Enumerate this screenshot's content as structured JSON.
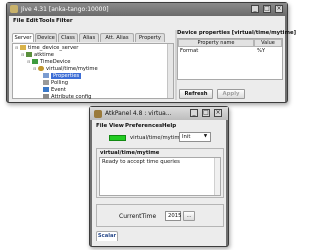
{
  "colors": {
    "state_on": "#22cc22",
    "selection": "#3d6ed6"
  },
  "jive": {
    "title": "Jive 4.31  [anka-tango:10000]",
    "menu": [
      "File",
      "Edit",
      "Tools",
      "Filter"
    ],
    "tabs": [
      "Server",
      "Device",
      "Class",
      "Alias",
      "Att. Alias",
      "Property"
    ],
    "tree": [
      {
        "label": "time_device_server",
        "icon": "folder-icon"
      },
      {
        "label": "atktime",
        "icon": "server-icon"
      },
      {
        "label": "TimeDevice",
        "icon": "class-icon"
      },
      {
        "label": "virtual/time/mytime",
        "icon": "device-icon"
      },
      {
        "label": "Properties",
        "icon": "properties-icon"
      },
      {
        "label": "Polling",
        "icon": "polling-icon"
      },
      {
        "label": "Event",
        "icon": "event-icon"
      },
      {
        "label": "Attribute config",
        "icon": "attribute-icon"
      }
    ],
    "panel_title": "Device properties [virtual/time/mytime]",
    "table_headers": [
      "Property name",
      "Value"
    ],
    "table_rows": [
      {
        "name": "Format",
        "value": "%Y"
      }
    ],
    "refresh_label": "Refresh",
    "apply_label": "Apply"
  },
  "atk": {
    "title": "AtkPanel 4.8 : virtua...",
    "menu": [
      "File",
      "View",
      "Preferences",
      "Help"
    ],
    "device_name": "virtual/time/mytime",
    "state": "Init",
    "status_title": "virtual/time/mytime",
    "status_text": "Ready to accept time queries",
    "attr_label": "CurrentTime",
    "attr_value": "2015",
    "more_button": "...",
    "tab": "Scalar"
  }
}
